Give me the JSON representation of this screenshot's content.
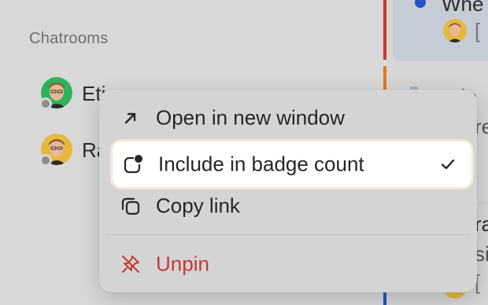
{
  "sidebar": {
    "section_label": "Chatrooms",
    "rooms": [
      {
        "name": "Eti",
        "presence": "offline"
      },
      {
        "name": "Ra",
        "presence": "offline"
      }
    ]
  },
  "timeline": {
    "top_text": "Whe",
    "top_bracket": "[",
    "mid_text": "Etie",
    "mid_text2": "re",
    "low_text": "ra",
    "low_text2": "si",
    "low_bracket": "["
  },
  "context_menu": {
    "items": [
      {
        "label": "Open in new window",
        "icon": "arrow-up-right-icon"
      },
      {
        "label": "Include in badge count",
        "icon": "badge-count-icon",
        "checked": true
      },
      {
        "label": "Copy link",
        "icon": "copy-icon"
      },
      {
        "label": "Unpin",
        "icon": "unpin-icon",
        "destructive": true
      }
    ]
  },
  "colors": {
    "unpin": "#c23a33",
    "unread_dot": "#2452c9",
    "divider_red": "#c43b31",
    "divider_orange": "#e07a1f",
    "avatar_green": "#2fb35a",
    "avatar_yellow": "#e6b93a"
  }
}
